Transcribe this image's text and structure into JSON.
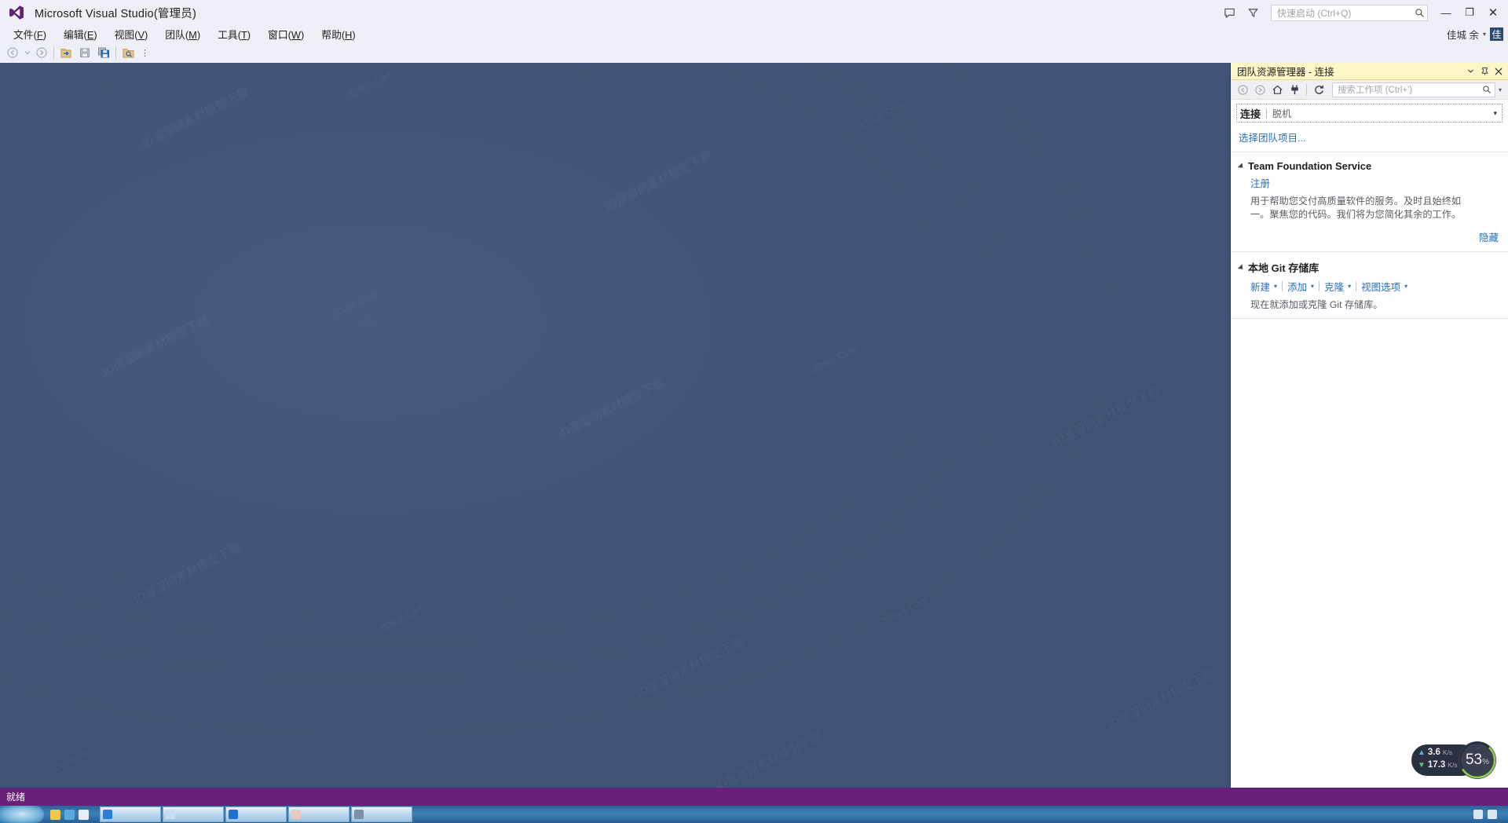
{
  "titlebar": {
    "app_title": "Microsoft Visual Studio(管理员)",
    "logo_icon": "visual-studio-logo",
    "feedback_icon": "feedback-icon",
    "filter_icon": "filter-icon",
    "quick_launch_placeholder": "快速启动 (Ctrl+Q)",
    "search_icon": "search-icon",
    "minimize_label": "—",
    "restore_label": "❐",
    "close_label": "✕",
    "user_name": "佳城 余",
    "user_caret": "▾",
    "user_avatar_initial": "佳"
  },
  "menubar": {
    "items": [
      {
        "label": "文件",
        "accel": "F"
      },
      {
        "label": "编辑",
        "accel": "E"
      },
      {
        "label": "视图",
        "accel": "V"
      },
      {
        "label": "团队",
        "accel": "M"
      },
      {
        "label": "工具",
        "accel": "T"
      },
      {
        "label": "窗口",
        "accel": "W"
      },
      {
        "label": "帮助",
        "accel": "H"
      }
    ]
  },
  "toolbar": {
    "buttons": [
      {
        "name": "navigate-backward-icon",
        "enabled": false
      },
      {
        "name": "navigate-backward-dropdown-icon",
        "enabled": false
      },
      {
        "name": "navigate-forward-icon",
        "enabled": false
      },
      {
        "name": "new-project-icon",
        "enabled": true
      },
      {
        "name": "save-icon",
        "enabled": true
      },
      {
        "name": "save-all-icon",
        "enabled": true
      },
      {
        "name": "find-in-files-icon",
        "enabled": true
      }
    ],
    "overflow_label": "⋮"
  },
  "team_explorer": {
    "header": {
      "title": "团队资源管理器 - 连接",
      "dropdown_icon": "chevron-down-icon",
      "pin_icon": "pin-icon",
      "close_icon": "close-icon"
    },
    "toolbar": {
      "back_icon": "back-arrow-icon",
      "forward_icon": "forward-arrow-icon",
      "home_icon": "home-icon",
      "connect_icon": "plug-connect-icon",
      "refresh_icon": "refresh-icon",
      "search_placeholder": "搜索工作项 (Ctrl+')",
      "search_icon": "search-icon",
      "search_dropdown_icon": "chevron-down-icon"
    },
    "connect_bar": {
      "label": "连接",
      "sub_label": "脱机",
      "caret": "▾"
    },
    "select_project_link": "选择团队项目...",
    "sections": [
      {
        "title": "Team Foundation Service",
        "link": "注册",
        "description": "用于帮助您交付高质量软件的服务。及时且始终如一。聚焦您的代码。我们将为您简化其余的工作。",
        "action_link": "隐藏"
      },
      {
        "title": "本地 Git 存储库",
        "commands": [
          {
            "label": "新建",
            "caret": "▾"
          },
          {
            "label": "添加",
            "caret": "▾"
          },
          {
            "label": "克隆",
            "caret": "▾"
          },
          {
            "label": "视图选项",
            "caret": "▾"
          }
        ],
        "description": "现在就添加或克隆 Git 存储库。"
      }
    ]
  },
  "net_widget": {
    "upload_arrow": "▲",
    "upload_value": "3.6",
    "upload_unit": "K/s",
    "download_arrow": "▼",
    "download_value": "17.3",
    "download_unit": "K/s",
    "percent_value": "53",
    "percent_symbol": "%",
    "ring_color": "#8FD14F"
  },
  "statusbar": {
    "text": "就绪",
    "background_color": "#68217A"
  },
  "taskbar": {
    "start_label": "",
    "clock": ""
  },
  "colors": {
    "chrome": "#EEEFF7",
    "editor_background": "#3F5174",
    "panel_header": "#FFF6C8",
    "link": "#2A6FB5",
    "status_purple": "#68217A"
  },
  "watermarks": {
    "primary": "3Dso6.Com",
    "secondary": "3D溜溜网素材模型下载"
  }
}
